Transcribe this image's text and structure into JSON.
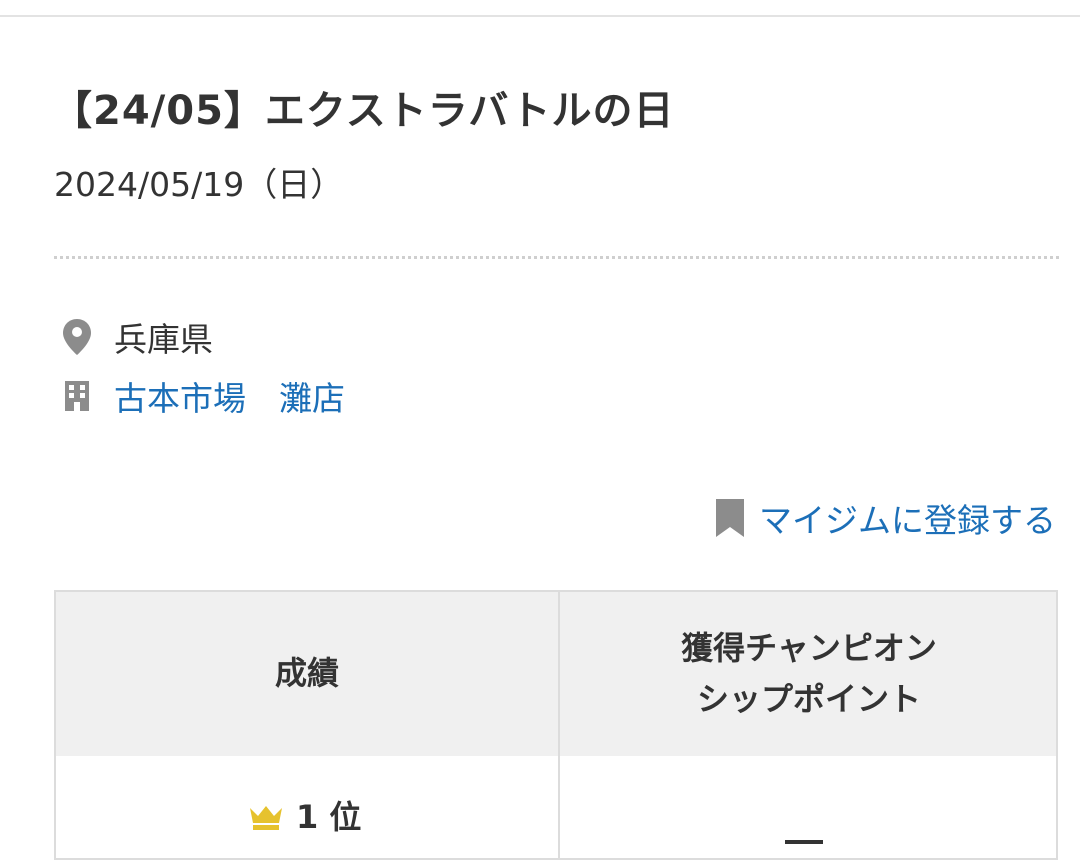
{
  "event": {
    "title": "【24/05】エクストラバトルの日",
    "date": "2024/05/19（日）"
  },
  "location": {
    "icon": "map-pin-icon",
    "prefecture": "兵庫県"
  },
  "venue": {
    "icon": "building-icon",
    "name": "古本市場　灘店"
  },
  "mygym": {
    "icon": "bookmark-icon",
    "label": "マイジムに登録する"
  },
  "results_table": {
    "headers": [
      "成績",
      "獲得チャンピオン\nシップポイント"
    ],
    "rows": [
      {
        "rank_icon": "crown-icon",
        "rank": "1 位",
        "points": "—"
      }
    ]
  },
  "colors": {
    "text": "#333333",
    "link": "#1c6fb8",
    "icon_gray": "#8c8c8c",
    "crown_gold": "#e6c22e",
    "table_header_bg": "#f0f0f0",
    "border": "#dcdcdc"
  }
}
